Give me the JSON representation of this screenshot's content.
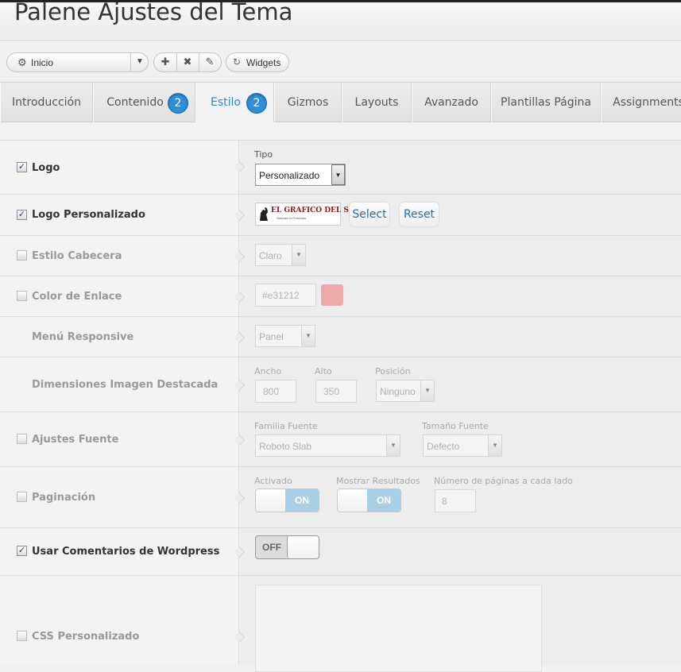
{
  "window": {
    "title": "Palene Ajustes del Tema"
  },
  "toolbar": {
    "preset_label": "Inicio",
    "widgets_label": "Widgets",
    "icons": [
      "gear-icon",
      "chevron-down-icon",
      "add-icon",
      "delete-icon",
      "edit-icon",
      "refresh-icon"
    ]
  },
  "tabs": [
    {
      "label": "Introducción"
    },
    {
      "label": "Contenido",
      "badge": "2"
    },
    {
      "label": "Estilo",
      "badge": "2",
      "active": true
    },
    {
      "label": "Gizmos"
    },
    {
      "label": "Layouts"
    },
    {
      "label": "Avanzado"
    },
    {
      "label": "Plantillas Página"
    },
    {
      "label": "Assignments"
    }
  ],
  "rows": {
    "logo": {
      "label": "Logo",
      "checked": true,
      "field_label": "Tipo",
      "value": "Personalizado"
    },
    "custom_logo": {
      "label": "Logo Personalizado",
      "checked": true,
      "logo_text": "EL GRAFICO DEL SUR",
      "logo_subtext": "Noticias en Primicias",
      "select_label": "Select",
      "reset_label": "Reset"
    },
    "header_style": {
      "label": "Estilo Cabecera",
      "checked": false,
      "value": "Claro"
    },
    "link_color": {
      "label": "Color de Enlace",
      "checked": false,
      "value": "#e31212"
    },
    "responsive_menu": {
      "label": "Menú Responsive",
      "value": "Panel"
    },
    "featured_image": {
      "label": "Dimensiones Imagen Destacada",
      "width_label": "Ancho",
      "width": "800",
      "height_label": "Alto",
      "height": "350",
      "position_label": "Posición",
      "position": "Ninguno"
    },
    "font": {
      "label": "Ajustes Fuente",
      "checked": false,
      "family_label": "Familia Fuente",
      "family": "Roboto Slab",
      "size_label": "Tamaño Fuente",
      "size": "Defecto"
    },
    "pagination": {
      "label": "Paginación",
      "checked": false,
      "enabled_label": "Activado",
      "enabled": "ON",
      "show_results_label": "Mostrar Resultados",
      "show_results": "ON",
      "pages_label": "Número de páginas a cada lado",
      "pages": "8"
    },
    "comments": {
      "label": "Usar Comentarios de Wordpress",
      "checked": true,
      "value": "OFF"
    },
    "css": {
      "label": "CSS Personalizado",
      "checked": false
    }
  },
  "colors": {
    "accent": "#2e8ed6",
    "swatch": "#eda9aa",
    "toggle_on": "#a9cfe6"
  }
}
